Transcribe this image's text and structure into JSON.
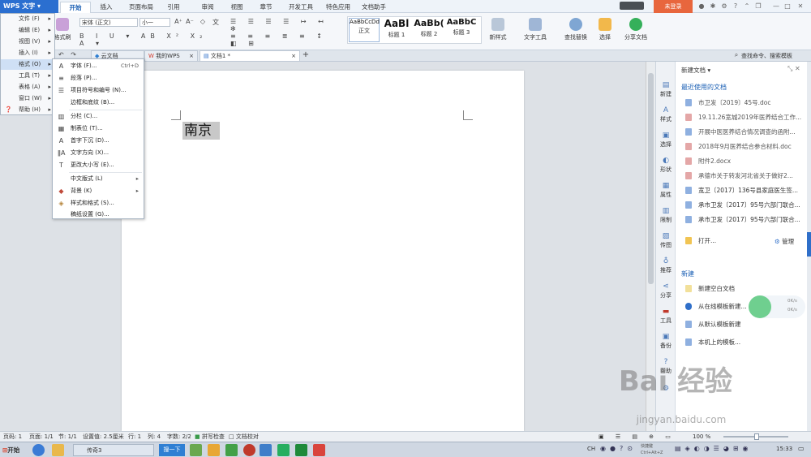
{
  "app": {
    "brand": "WPS 文字",
    "login": "未登录"
  },
  "ribbon_tabs": [
    "开始",
    "插入",
    "页面布局",
    "引用",
    "审阅",
    "视图",
    "章节",
    "开发工具",
    "特色应用",
    "文档助手"
  ],
  "ribbon": {
    "painter": "格式刷",
    "font": "宋体 (正文)",
    "size": "小一",
    "styles": [
      {
        "preview": "AaBbCcDd",
        "name": "正文"
      },
      {
        "preview": "AaBl",
        "name": "标题 1"
      },
      {
        "preview": "AaBb(",
        "name": "标题 2"
      },
      {
        "preview": "AaBbC",
        "name": "标题 3"
      }
    ],
    "new_style": "新样式",
    "text_tool": "文字工具",
    "find_replace": "查找替换",
    "select": "选择",
    "share": "分享文档"
  },
  "doc_tabs": [
    "云文档",
    "我的WPS",
    "文档1 *"
  ],
  "search_cmd": "查找命令、搜索模板",
  "menu": {
    "items": [
      "文件 (F)",
      "编辑 (E)",
      "视图 (V)",
      "插入 (I)",
      "格式 (O)",
      "工具 (T)",
      "表格 (A)",
      "窗口 (W)",
      "帮助 (H)"
    ]
  },
  "format_menu": [
    {
      "label": "字体 (F)...",
      "shortcut": "Ctrl+D",
      "icon": "A"
    },
    {
      "label": "段落 (P)...",
      "icon": "≡"
    },
    {
      "label": "项目符号和编号 (N)...",
      "icon": "☰"
    },
    {
      "label": "边框和底纹 (B)...",
      "icon": ""
    },
    {
      "label": "分栏 (C)...",
      "icon": "▥"
    },
    {
      "label": "制表位 (T)...",
      "icon": "▦"
    },
    {
      "label": "首字下沉 (D)...",
      "icon": "A"
    },
    {
      "label": "文字方向 (X)...",
      "icon": "ǁA"
    },
    {
      "label": "更改大小写 (E)...",
      "icon": "T"
    },
    {
      "label": "中文版式 (L)",
      "icon": ""
    },
    {
      "label": "背景 (K)",
      "icon": "◆"
    },
    {
      "label": "样式和格式 (S)...",
      "icon": "◈"
    },
    {
      "label": "稿纸设置 (G)...",
      "icon": ""
    }
  ],
  "document": {
    "text": "南京"
  },
  "side_buttons": [
    "新建",
    "样式",
    "选择",
    "形状",
    "属性",
    "限制",
    "传图",
    "推荐",
    "分享",
    "工具",
    "备份",
    "帮助"
  ],
  "pane": {
    "title": "新建文档",
    "recent_title": "最近使用的文档",
    "recent": [
      "市卫发〔2019〕45号.doc",
      "19.11.26宽城2019年医养结合工作...",
      "开展中医医养结合情况调查的函附...",
      "2018年9月医养结合参合材料.doc",
      "附件2.docx",
      "承德市关于转发河北省关于做好2...",
      "宽卫〔2017〕136号县家庭医生签...",
      "承市卫发〔2017〕95号六部门联合...",
      "承市卫发〔2017〕95号六部门联合..."
    ],
    "open": "打开...",
    "manage": "管理",
    "new_title": "新建",
    "new_items": [
      "新建空白文档",
      "从在线模板新建...",
      "从默认模板新建",
      "本机上的模板..."
    ],
    "net_up": "0K/s",
    "net_down": "0K/s"
  },
  "status": {
    "page": "页码: 1",
    "pages": "页面: 1/1",
    "section": "节: 1/1",
    "setting": "设置值: 2.5厘米",
    "row": "行: 1",
    "col": "列: 4",
    "words": "字数: 2/2",
    "spell": "拼写检查",
    "proof": "文档校对",
    "zoom": "100 %"
  },
  "taskbar": {
    "start": "开始",
    "browser_tab": "传奇3",
    "search_btn": "搜一下",
    "time": "15:33",
    "lang": "CH",
    "hint": "快捷键 Ctrl+Alt+Z"
  },
  "watermark": {
    "text": "Bai 经验",
    "sub": "jingyan.baidu.com"
  }
}
